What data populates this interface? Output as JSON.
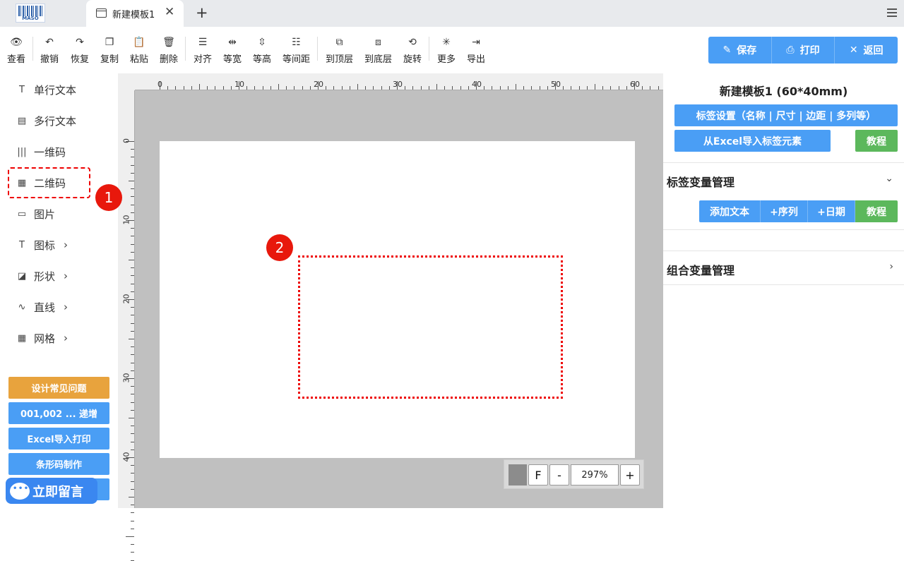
{
  "titlebar": {
    "logo_text": "MASO",
    "tab_label": "新建模板1",
    "close_glyph": "✕",
    "newtab_glyph": "+"
  },
  "toolbar": {
    "tools": [
      {
        "label": "查看",
        "icon": "eye-icon",
        "glyph": "👁"
      },
      {
        "label": "撤销",
        "icon": "undo-icon",
        "glyph": "↶"
      },
      {
        "label": "恢复",
        "icon": "redo-icon",
        "glyph": "↷"
      },
      {
        "label": "复制",
        "icon": "copy-icon",
        "glyph": "❐"
      },
      {
        "label": "粘贴",
        "icon": "paste-icon",
        "glyph": "📋"
      },
      {
        "label": "删除",
        "icon": "trash-icon",
        "glyph": "🗑"
      },
      {
        "label": "对齐",
        "icon": "align-icon",
        "glyph": "☰"
      },
      {
        "label": "等宽",
        "icon": "equal-width-icon",
        "glyph": "⇹"
      },
      {
        "label": "等高",
        "icon": "equal-height-icon",
        "glyph": "⇳"
      },
      {
        "label": "等间距",
        "icon": "equal-spacing-icon",
        "glyph": "☷"
      },
      {
        "label": "到顶层",
        "icon": "bring-front-icon",
        "glyph": "⧉"
      },
      {
        "label": "到底层",
        "icon": "send-back-icon",
        "glyph": "⧈"
      },
      {
        "label": "旋转",
        "icon": "rotate-icon",
        "glyph": "⟲"
      },
      {
        "label": "更多",
        "icon": "more-icon",
        "glyph": "✳"
      },
      {
        "label": "导出",
        "icon": "export-icon",
        "glyph": "⇥"
      }
    ],
    "save_label": "保存",
    "print_label": "打印",
    "back_label": "返回",
    "accent": "#4a9ef5"
  },
  "left_panel": {
    "items": [
      {
        "label": "单行文本",
        "icon": "text-icon",
        "glyph": "T"
      },
      {
        "label": "多行文本",
        "icon": "multiline-text-icon",
        "glyph": "▤"
      },
      {
        "label": "一维码",
        "icon": "barcode-icon",
        "glyph": "|||"
      },
      {
        "label": "二维码",
        "icon": "qrcode-icon",
        "glyph": "▦"
      },
      {
        "label": "图片",
        "icon": "image-icon",
        "glyph": "▭"
      },
      {
        "label": "图标",
        "icon": "icon-icon",
        "glyph": "T"
      },
      {
        "label": "形状",
        "icon": "shape-icon",
        "glyph": "◪"
      },
      {
        "label": "直线",
        "icon": "line-icon",
        "glyph": "∿"
      },
      {
        "label": "网格",
        "icon": "grid-icon",
        "glyph": "▦"
      }
    ],
    "arrow_glyph": "›",
    "buttons": [
      {
        "label": "设计常见问题",
        "color": "#e8a33d"
      },
      {
        "label": "001,002 ... 递增",
        "color": "#4a9ef5"
      },
      {
        "label": "Excel导入打印",
        "color": "#4a9ef5"
      },
      {
        "label": "条形码制作",
        "color": "#4a9ef5"
      }
    ],
    "chat_label": "立即留言"
  },
  "canvas": {
    "ruler_top": [
      "0",
      "10",
      "20",
      "30",
      "40",
      "50",
      "60"
    ],
    "ruler_left": [
      "0",
      "10",
      "20",
      "30",
      "40"
    ],
    "markers": [
      "1",
      "2"
    ],
    "zoom_value": "297%",
    "zoom_f": "F",
    "zoom_minus": "-",
    "zoom_plus": "+"
  },
  "right_panel": {
    "title": "新建模板1 (60*40mm)",
    "settings_label": "标签设置（名称 | 尺寸 | 边距 | 多列等）",
    "excel_import_label": "从Excel导入标签元素",
    "tutorial_label": "教程",
    "var_section_title": "标签变量管理",
    "var_buttons": [
      "添加文本",
      "+序列",
      "+日期"
    ],
    "var_tutorial_label": "教程",
    "combo_section_title": "组合变量管理",
    "green": "#5cb85c"
  }
}
